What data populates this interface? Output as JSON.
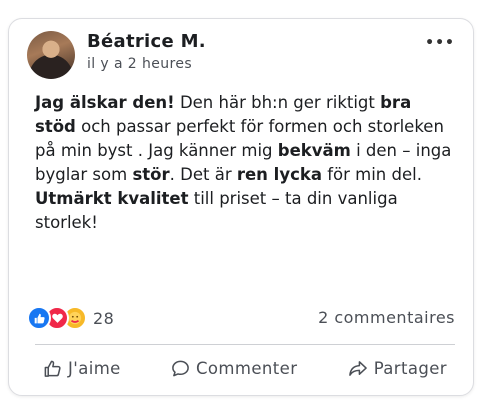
{
  "post": {
    "author": "Béatrice M.",
    "time": "il y a 2 heures",
    "more": "•••",
    "text": [
      {
        "t": "Jag älskar den!",
        "b": true
      },
      {
        "t": " Den här bh:n ger riktigt ",
        "b": false
      },
      {
        "t": "bra stöd",
        "b": true
      },
      {
        "t": " och passar perfekt för formen och storleken på min byst . Jag känner mig ",
        "b": false
      },
      {
        "t": "bekväm",
        "b": true
      },
      {
        "t": " i den – inga byglar som ",
        "b": false
      },
      {
        "t": "stör",
        "b": true
      },
      {
        "t": ". Det är ",
        "b": false
      },
      {
        "t": "ren lycka",
        "b": true
      },
      {
        "t": " för min del.",
        "b": false
      },
      {
        "t": "\n",
        "b": false
      },
      {
        "t": "Utmärkt kvalitet",
        "b": true
      },
      {
        "t": " till priset – ta din vanliga storlek!",
        "b": false
      }
    ]
  },
  "reactions": {
    "icons": [
      "like-icon",
      "love-icon",
      "care-icon"
    ],
    "count": "28"
  },
  "comments_label": "2 commentaires",
  "actions": {
    "like": "J'aime",
    "comment": "Commenter",
    "share": "Partager"
  },
  "colors": {
    "like": "#1877f2",
    "love": "#f02849",
    "care": "#f7b928"
  }
}
